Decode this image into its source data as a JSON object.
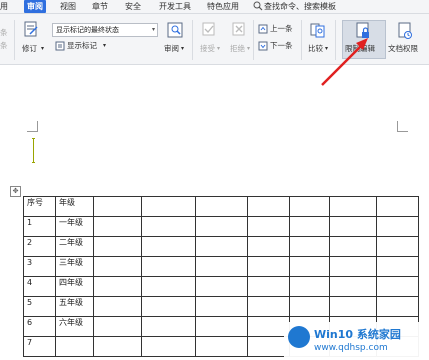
{
  "menubar": {
    "items": [
      "用",
      "审阅",
      "视图",
      "章节",
      "安全",
      "开发工具",
      "特色应用"
    ],
    "active_index": 1,
    "search": "查找命令、搜索模板"
  },
  "ribbon": {
    "track_changes": "修订",
    "display_mode": "显示标记的最终状态",
    "show_markup": "显示标记",
    "review": "审阅",
    "accept": "接受",
    "reject": "拒绝",
    "prev": "上一条",
    "next": "下一条",
    "compare": "比较",
    "restrict_edit": "限制编辑",
    "doc_permission": "文档权限",
    "left_partial": "条",
    "accent_color": "#2f6fdf",
    "arrow_color": "#e02020"
  },
  "table": {
    "header": [
      "序号",
      "年级"
    ],
    "rows": [
      [
        "1",
        "一年级"
      ],
      [
        "2",
        "二年级"
      ],
      [
        "3",
        "三年级"
      ],
      [
        "4",
        "四年级"
      ],
      [
        "5",
        "五年级"
      ],
      [
        "6",
        "六年级"
      ],
      [
        "7",
        ""
      ]
    ]
  },
  "watermark": {
    "title": "Win10 系统家园",
    "url": "www.qdhsp.com"
  }
}
